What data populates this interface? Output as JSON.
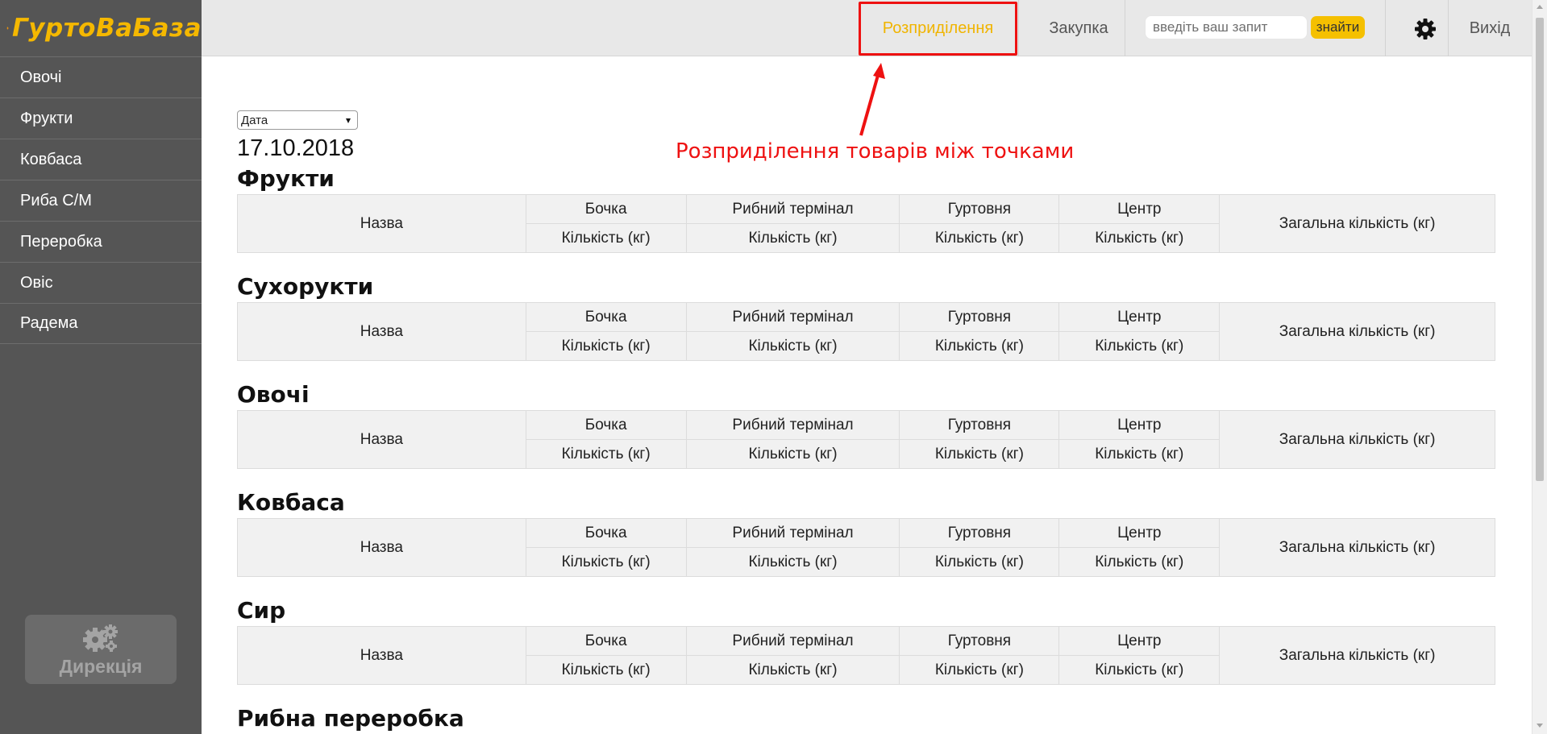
{
  "app": {
    "logo_text": "ГуртоВаБаза"
  },
  "sidebar": {
    "items": [
      {
        "label": "Овочі"
      },
      {
        "label": "Фрукти"
      },
      {
        "label": "Ковбаса"
      },
      {
        "label": "Риба С/М"
      },
      {
        "label": "Переробка"
      },
      {
        "label": "Овіс"
      },
      {
        "label": "Радема"
      }
    ],
    "direction_button": "Дирекція"
  },
  "header": {
    "nav": [
      {
        "label": "Розприділення",
        "active": true
      },
      {
        "label": "Закупка",
        "active": false
      }
    ],
    "search_placeholder": "введіть ваш запит",
    "search_button": "знайти",
    "settings_icon": "gear-icon",
    "logout": "Вихід"
  },
  "annotation": {
    "text": "Розприділення товарів між точками",
    "color": "#ee1111"
  },
  "main": {
    "date_select": "Дата",
    "date_value": "17.10.2018",
    "columns": {
      "name": "Назва",
      "locations": [
        "Бочка",
        "Рибний термінал",
        "Гуртовня",
        "Центр"
      ],
      "quantity": "Кількість (кг)",
      "total": "Загальна кількість (кг)"
    },
    "sections": [
      {
        "title": "Фрукти"
      },
      {
        "title": "Сухорукти"
      },
      {
        "title": "Овочі"
      },
      {
        "title": "Ковбаса"
      },
      {
        "title": "Сир"
      },
      {
        "title": "Рибна переробка"
      }
    ]
  },
  "colors": {
    "accent": "#f5c000",
    "sidebar_bg": "#555555",
    "header_bg": "#e8e8e8",
    "table_bg": "#f1f1f1"
  }
}
